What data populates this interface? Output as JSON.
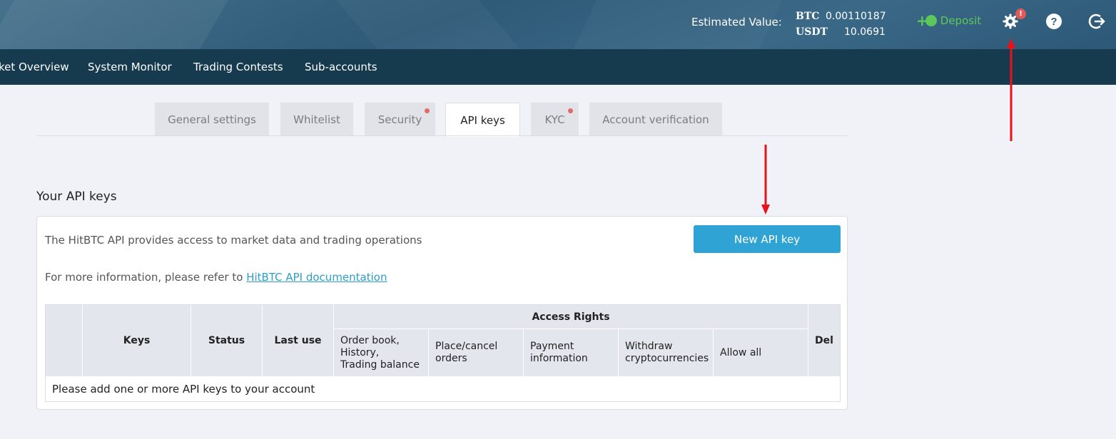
{
  "header": {
    "estimated_label": "Estimated Value:",
    "balances": [
      {
        "currency": "BTC",
        "amount": "0.00110187"
      },
      {
        "currency": "USDT",
        "amount": "10.0691"
      }
    ],
    "deposit_label": "Deposit",
    "settings_badge": "!",
    "icons": [
      "gear-icon",
      "help-icon",
      "logout-icon"
    ]
  },
  "nav": {
    "items": [
      "ket Overview",
      "System Monitor",
      "Trading Contests",
      "Sub-accounts"
    ]
  },
  "tabs": [
    {
      "label": "General settings"
    },
    {
      "label": "Whitelist"
    },
    {
      "label": "Security"
    },
    {
      "label": "API keys"
    },
    {
      "label": "KYC"
    },
    {
      "label": "Account verification"
    }
  ],
  "main": {
    "title": "Your API keys",
    "info_text": "The HitBTC API provides access to market data and trading operations",
    "more_info_prefix": "For more information, please refer to",
    "doc_link": "HitBTC API documentation",
    "new_key_button": "New API key",
    "table": {
      "col_keys": "Keys",
      "col_status": "Status",
      "col_last_use": "Last use",
      "access_rights": "Access Rights",
      "rights": [
        "Order book,\nHistory,\nTrading balance",
        "Place/cancel\norders",
        "Payment\ninformation",
        "Withdraw\ncryptocurrencies",
        "Allow all"
      ],
      "col_del": "Del",
      "empty_message": "Please add one or more API keys to your account"
    }
  },
  "colors": {
    "header_bg": "#325d7b",
    "nav_bg": "#163a4e",
    "accent": "#2fa3d3",
    "deposit": "#5cc85b",
    "arrow": "#e8121b"
  }
}
